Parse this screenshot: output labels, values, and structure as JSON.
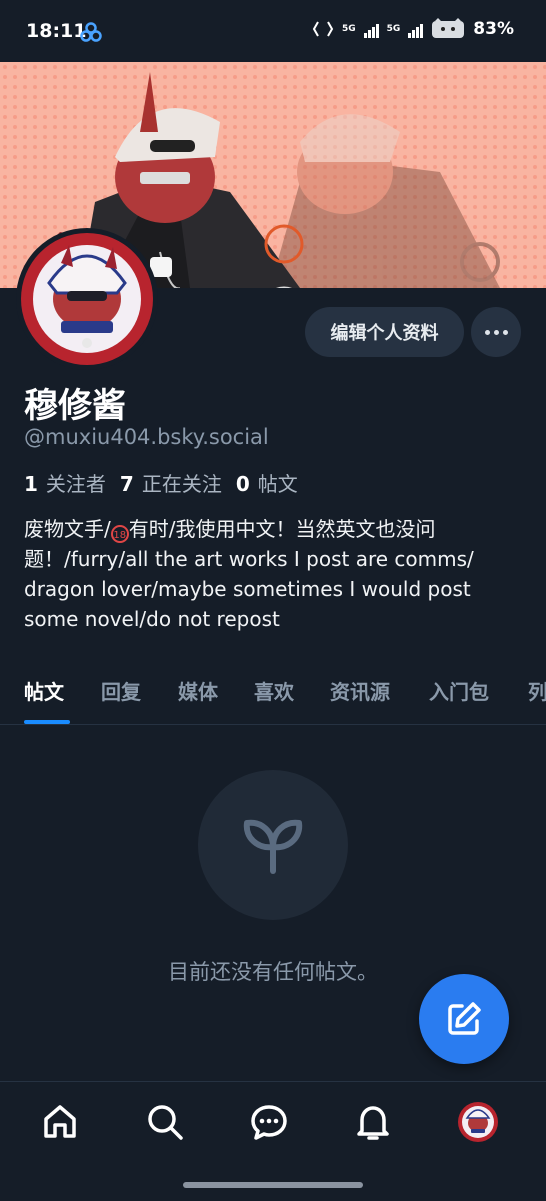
{
  "status_bar": {
    "time": "18:11",
    "network_1": "5G",
    "network_2": "5G",
    "battery": "83%"
  },
  "profile": {
    "display_name": "穆修酱",
    "handle": "@muxiu404.bsky.social",
    "edit_button": "编辑个人资料",
    "followers_count": "1",
    "followers_label": "关注者",
    "following_count": "7",
    "following_label": "正在关注",
    "posts_count": "0",
    "posts_label": "帖文",
    "bio_part1": "废物文手/",
    "bio_icon": "18",
    "bio_part2": "有时/我使用中文！当然英文也没问题！/furry/all the art works I post are comms/ dragon lover/maybe sometimes I would post some novel/do not repost"
  },
  "tabs": [
    {
      "label": "帖文",
      "active": true
    },
    {
      "label": "回复",
      "active": false
    },
    {
      "label": "媒体",
      "active": false
    },
    {
      "label": "喜欢",
      "active": false
    },
    {
      "label": "资讯源",
      "active": false
    },
    {
      "label": "入门包",
      "active": false
    },
    {
      "label": "列",
      "active": false
    }
  ],
  "empty_state": {
    "icon": "sprout-icon",
    "message": "目前还没有任何帖文。"
  },
  "colors": {
    "background": "#151d28",
    "accent": "#2a7cf0",
    "tab_underline": "#1a8cff",
    "banner": "#f7a48f"
  },
  "bottom_nav": [
    "home-icon",
    "search-icon",
    "chat-icon",
    "bell-icon",
    "profile-avatar"
  ]
}
